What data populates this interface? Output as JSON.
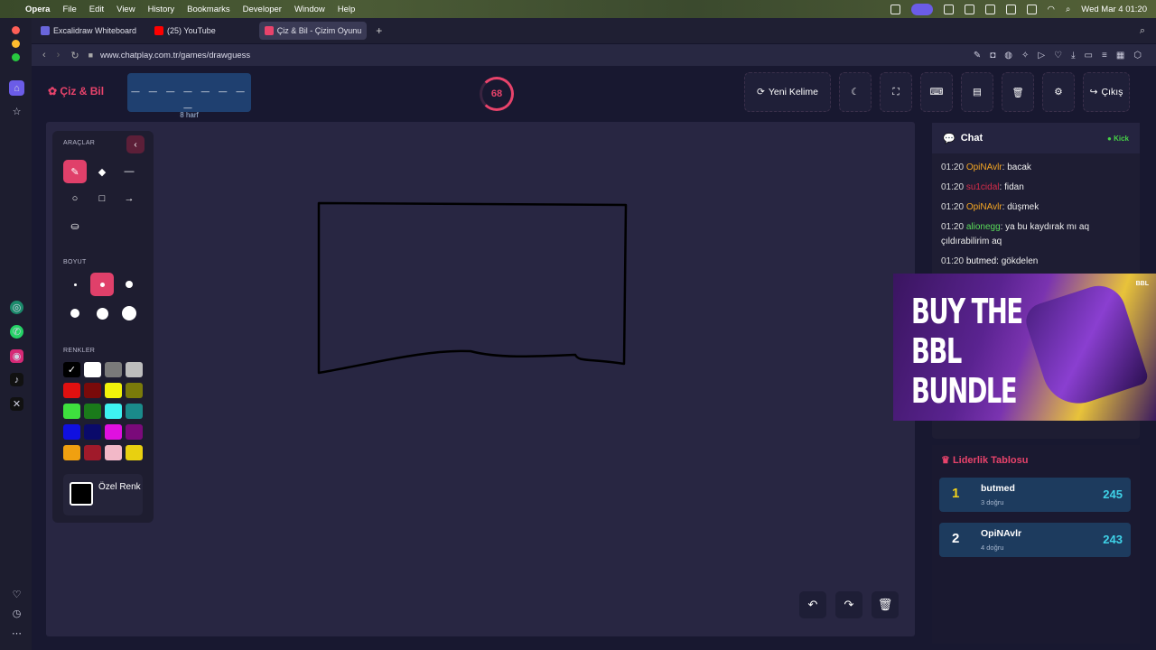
{
  "menubar": {
    "app": "Opera",
    "items": [
      "File",
      "Edit",
      "View",
      "History",
      "Bookmarks",
      "Developer",
      "Window",
      "Help"
    ],
    "datetime": "Wed Mar 4  01:20"
  },
  "tabs": [
    {
      "label": "Excalidraw Whiteboard",
      "active": false,
      "color": "#6965db"
    },
    {
      "label": "(25) YouTube",
      "active": false,
      "color": "#ff0000"
    },
    {
      "label": "Çiz & Bil - Çizim Oyunu",
      "active": true,
      "color": "#e8436b"
    }
  ],
  "address": {
    "url": "www.chatplay.com.tr/games/drawguess"
  },
  "game": {
    "logo": "Çiz & Bil",
    "word_mask": "_ _ _ _ _ _ _ _",
    "word_hint": "8 harf",
    "timer": "68",
    "new_word": "Yeni Kelime",
    "exit": "Çıkış"
  },
  "tools": {
    "tools_title": "ARAÇLAR",
    "size_title": "BOYUT",
    "colors_title": "RENKLER",
    "custom_color": "Özel Renk",
    "colors": [
      "#000000",
      "#ffffff",
      "#7a7a7a",
      "#bdbdbd",
      "#e01010",
      "#7a0a0a",
      "#f2f20a",
      "#7a7a0a",
      "#3ee03e",
      "#1a7a1a",
      "#3ef2f2",
      "#1a8a8a",
      "#1010e0",
      "#0a0a6a",
      "#e010e0",
      "#7a0a7a",
      "#f0a010",
      "#a01a2a",
      "#f2b8c8",
      "#e8d010"
    ]
  },
  "chat": {
    "title": "Chat",
    "status": "Kick",
    "messages": [
      {
        "time": "01:20",
        "user": "OpiNAvlr",
        "user_color": "#f5a623",
        "text": ": bacak"
      },
      {
        "time": "01:20",
        "user": "su1cidal",
        "user_color": "#d62c4a",
        "text": ": fidan"
      },
      {
        "time": "01:20",
        "user": "OpiNAvlr",
        "user_color": "#f5a623",
        "text": ": düşmek"
      },
      {
        "time": "01:20",
        "user": "alionegg",
        "user_color": "#5adc5a",
        "text": ": ya bu kaydırak mı aq çıldırabilirim aq"
      },
      {
        "time": "01:20",
        "user": "butmed",
        "user_color": "#ffffff",
        "text": ": gökdelen"
      }
    ]
  },
  "ad": {
    "headline": "BUY THE BBL BUNDLE",
    "brand": "BBL"
  },
  "leaderboard": {
    "title": "Liderlik Tablosu",
    "rows": [
      {
        "rank": "1",
        "name": "butmed",
        "sub": "3 doğru",
        "score": "245",
        "rank_color": "#f2d21a"
      },
      {
        "rank": "2",
        "name": "OpiNAvlr",
        "sub": "4 doğru",
        "score": "243",
        "rank_color": "#ffffff"
      }
    ]
  }
}
